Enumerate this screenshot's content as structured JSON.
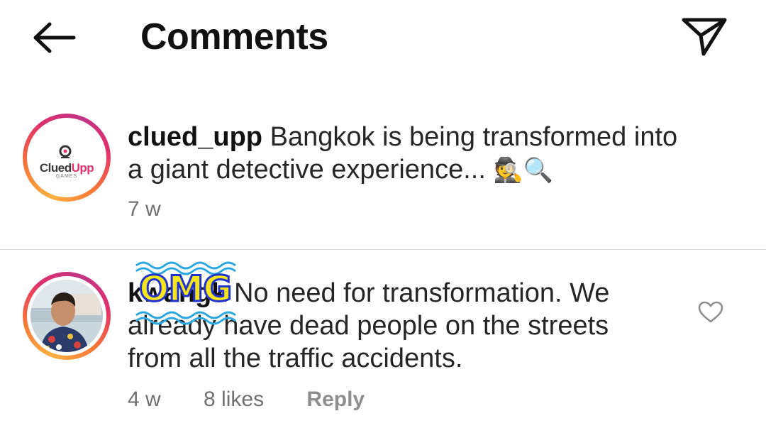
{
  "header": {
    "title": "Comments",
    "back_icon": "arrow-left-icon",
    "send_icon": "paper-plane-icon"
  },
  "comments": [
    {
      "username": "clued_upp",
      "text": "Bangkok is being transformed into a giant detective experience...",
      "emojis": "🕵🔍",
      "age": "7 w",
      "avatar": {
        "brand_main": "Clued",
        "brand_accent": "Upp",
        "brand_sub": "GAMES"
      }
    },
    {
      "username": "kwangk",
      "username_visible_end": "k",
      "text": "No need for transformation. We already have dead people on the streets from all the traffic accidents.",
      "age": "4 w",
      "likes": "8 likes",
      "reply": "Reply",
      "like_icon": "heart-outline-icon",
      "sticker_text": "OMG"
    }
  ],
  "colors": {
    "accent_pink": "#e1306c",
    "accent_orange": "#f77737",
    "meta_gray": "#707070",
    "divider": "#dbdbdb",
    "sticker_fill": "#f5e51d",
    "sticker_outline": "#2233cc"
  }
}
